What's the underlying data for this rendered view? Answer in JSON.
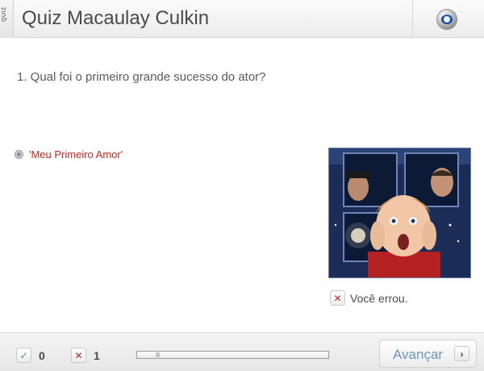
{
  "header": {
    "tab_label": "QUIZ",
    "title": "Quiz Macaulay Culkin",
    "logo_icon": "globe-logo-icon"
  },
  "question": {
    "text": "1. Qual foi o primeiro grande sucesso do ator?"
  },
  "answer": {
    "label": "'Meu Primeiro Amor'",
    "color": "#d0241b"
  },
  "feedback": {
    "icon": "x-icon",
    "text": "Você errou."
  },
  "footer": {
    "correct_count": "0",
    "wrong_count": "1",
    "progress_fraction": 0.1,
    "next_label": "Avançar",
    "next_icon": "chevron-right-icon"
  },
  "colors": {
    "accent_link": "#6f93c2",
    "wrong": "#c8271f",
    "correct": "#4aa33d"
  }
}
